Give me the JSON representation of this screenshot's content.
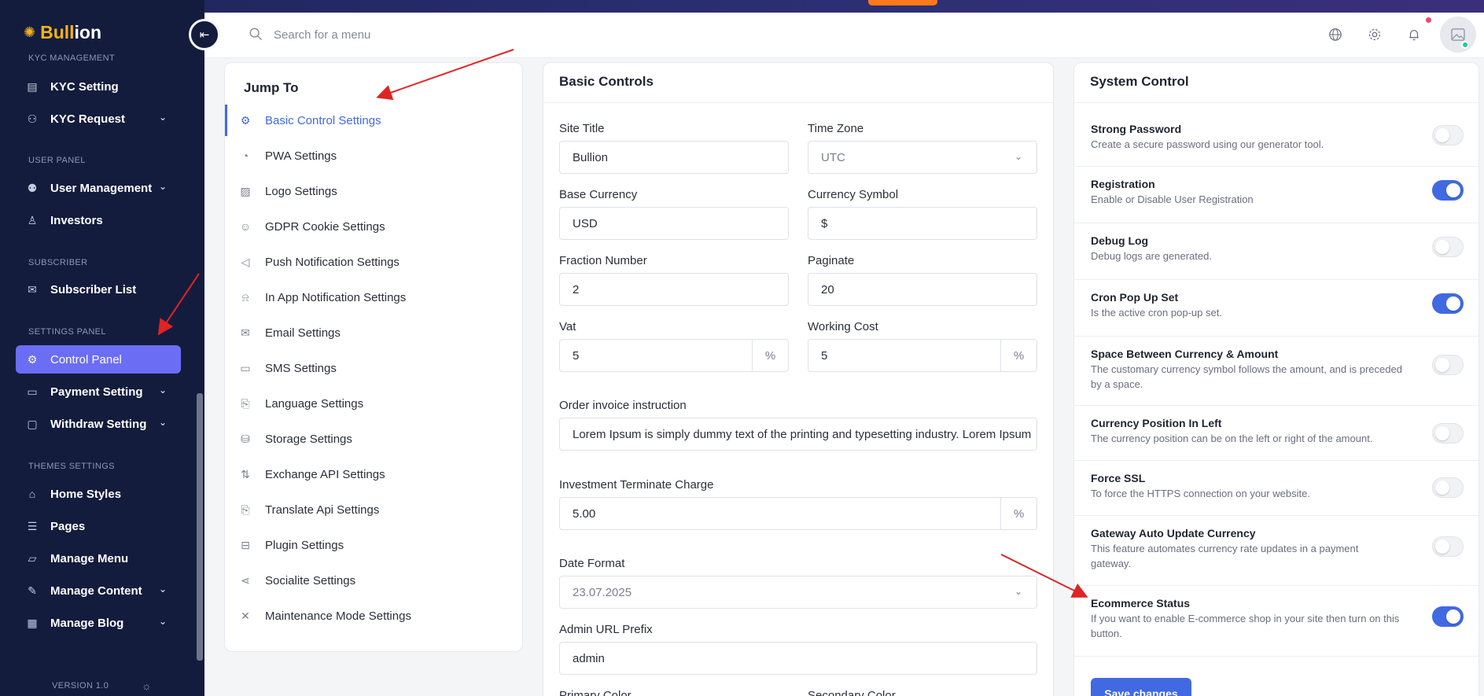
{
  "app": {
    "logo_part1": "Bull",
    "logo_part2": "ion"
  },
  "header": {
    "search_placeholder": "Search for a menu",
    "icons": [
      "globe-icon",
      "gear-icon",
      "bell-icon",
      "avatar-image-icon"
    ]
  },
  "sidebar": {
    "sections": {
      "kyc": "KYC MANAGEMENT",
      "user": "USER PANEL",
      "subscriber": "SUBSCRIBER",
      "settings": "SETTINGS PANEL",
      "themes": "THEMES SETTINGS"
    },
    "items": [
      {
        "label": "KYC Setting",
        "icon": "kyc-setting-icon"
      },
      {
        "label": "KYC Request",
        "icon": "kyc-request-icon",
        "has_submenu": true
      },
      {
        "label": "User Management",
        "icon": "users-icon",
        "has_submenu": true
      },
      {
        "label": "Investors",
        "icon": "investor-icon"
      },
      {
        "label": "Subscriber List",
        "icon": "mail-icon"
      },
      {
        "label": "Control Panel",
        "icon": "gear-icon",
        "active": true
      },
      {
        "label": "Payment Setting",
        "icon": "payment-icon",
        "has_submenu": true
      },
      {
        "label": "Withdraw Setting",
        "icon": "wallet-icon",
        "has_submenu": true
      },
      {
        "label": "Home Styles",
        "icon": "home-icon"
      },
      {
        "label": "Pages",
        "icon": "pages-icon"
      },
      {
        "label": "Manage Menu",
        "icon": "folder-icon"
      },
      {
        "label": "Manage Content",
        "icon": "pen-icon",
        "has_submenu": true
      },
      {
        "label": "Manage Blog",
        "icon": "blog-icon",
        "has_submenu": true
      }
    ],
    "version": "VERSION 1.0"
  },
  "jump_to": {
    "title": "Jump To",
    "items": [
      {
        "label": "Basic Control Settings",
        "active": true
      },
      {
        "label": "PWA Settings"
      },
      {
        "label": "Logo Settings"
      },
      {
        "label": "GDPR Cookie Settings"
      },
      {
        "label": "Push Notification Settings"
      },
      {
        "label": "In App Notification Settings"
      },
      {
        "label": "Email Settings"
      },
      {
        "label": "SMS Settings"
      },
      {
        "label": "Language Settings"
      },
      {
        "label": "Storage Settings"
      },
      {
        "label": "Exchange API Settings"
      },
      {
        "label": "Translate Api Settings"
      },
      {
        "label": "Plugin Settings"
      },
      {
        "label": "Socialite Settings"
      },
      {
        "label": "Maintenance Mode Settings"
      }
    ]
  },
  "basic_controls": {
    "title": "Basic Controls",
    "site_title": {
      "label": "Site Title",
      "value": "Bullion"
    },
    "time_zone": {
      "label": "Time Zone",
      "value": "UTC"
    },
    "base_currency": {
      "label": "Base Currency",
      "value": "USD"
    },
    "currency_symbol": {
      "label": "Currency Symbol",
      "value": "$"
    },
    "fraction_number": {
      "label": "Fraction Number",
      "value": "2"
    },
    "paginate": {
      "label": "Paginate",
      "value": "20"
    },
    "vat": {
      "label": "Vat",
      "value": "5",
      "suffix": "%"
    },
    "working_cost": {
      "label": "Working Cost",
      "value": "5",
      "suffix": "%"
    },
    "order_invoice": {
      "label": "Order invoice instruction",
      "value": "Lorem Ipsum is simply dummy text of the printing and typesetting industry. Lorem Ipsum"
    },
    "investment_terminate": {
      "label": "Investment Terminate Charge",
      "value": "5.00",
      "suffix": "%"
    },
    "date_format": {
      "label": "Date Format",
      "value": "23.07.2025"
    },
    "admin_url": {
      "label": "Admin URL Prefix",
      "value": "admin"
    },
    "primary_color": {
      "label": "Primary Color"
    },
    "secondary_color": {
      "label": "Secondary Color"
    }
  },
  "system_control": {
    "title": "System Control",
    "rows": [
      {
        "title": "Strong Password",
        "desc": "Create a secure password using our generator tool.",
        "on": false
      },
      {
        "title": "Registration",
        "desc": "Enable or Disable User Registration",
        "on": true
      },
      {
        "title": "Debug Log",
        "desc": "Debug logs are generated.",
        "on": false
      },
      {
        "title": "Cron Pop Up Set",
        "desc": "Is the active cron pop-up set.",
        "on": true
      },
      {
        "title": "Space Between Currency & Amount",
        "desc": "The customary currency symbol follows the amount, and is preceded by a space.",
        "on": false
      },
      {
        "title": "Currency Position In Left",
        "desc": "The currency position can be on the left or right of the amount.",
        "on": false
      },
      {
        "title": "Force SSL",
        "desc": "To force the HTTPS connection on your website.",
        "on": false
      },
      {
        "title": "Gateway Auto Update Currency",
        "desc": "This feature automates currency rate updates in a payment gateway.",
        "on": false
      },
      {
        "title": "Ecommerce Status",
        "desc": "If you want to enable E-commerce shop in your site then turn on this button.",
        "on": true
      }
    ],
    "save_label": "Save changes"
  },
  "colors": {
    "sidebar_bg": "#141c3d",
    "accent": "#4169e1",
    "active_nav": "#6b6ef5",
    "logo_gold": "#f5b21b"
  }
}
